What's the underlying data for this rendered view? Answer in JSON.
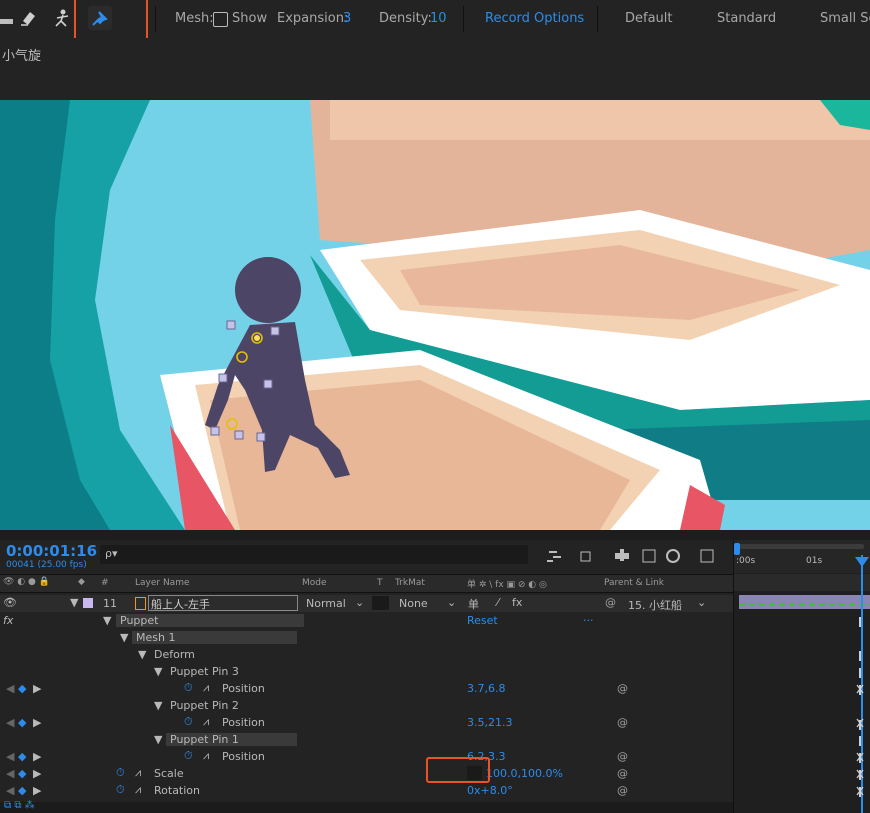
{
  "toolbar": {
    "tools": [
      {
        "name": "shape-tool-icon",
        "glyph": "▬"
      },
      {
        "name": "eraser-icon",
        "glyph": "◆"
      },
      {
        "name": "roto-brush-icon",
        "glyph": "✦"
      },
      {
        "name": "puppet-pin-icon",
        "glyph": "📌"
      }
    ],
    "mesh_label": "Mesh:",
    "show_label": "Show",
    "expansion_label": "Expansion:",
    "expansion_value": "3",
    "density_label": "Density:",
    "density_value": "10",
    "record_options": "Record Options",
    "workspaces": [
      "Default",
      "Standard",
      "Small Scr"
    ]
  },
  "comp": {
    "name": "小气旋"
  },
  "timeline": {
    "time": "0:00:01:16",
    "frame": "00041 (25.00 fps)",
    "search_placeholder": "ρ▾",
    "ruler": [
      ":00s",
      "01s"
    ],
    "columns": {
      "layer_name": "Layer Name",
      "mode": "Mode",
      "t": "T",
      "trkmat": "TrkMat",
      "switches": "单 ✲ \\ fx ▣ ⊘ ◐ ◎",
      "parent": "Parent & Link",
      "num": "#"
    },
    "layer": {
      "num": "11",
      "name": "船上人-左手",
      "mode": "Normal",
      "trkmat": "None",
      "parent": "15. 小红船"
    },
    "effects": {
      "fx": "fx",
      "puppet": "Puppet",
      "reset": "Reset",
      "reset_dash": "...",
      "mesh": "Mesh 1",
      "deform": "Deform",
      "pin3": "Puppet Pin 3",
      "pin3_pos_label": "Position",
      "pin3_pos": "3.7,6.8",
      "pin2": "Puppet Pin 2",
      "pin2_pos_label": "Position",
      "pin2_pos": "3.5,21.3",
      "pin1": "Puppet Pin 1",
      "pin1_pos_label": "Position",
      "pin1_pos": "6.2,3.3",
      "scale_label": "Scale",
      "scale_val": "100.0,100.0%",
      "rotation_label": "Rotation",
      "rotation_val": "0x+8.0°"
    }
  },
  "colors": {
    "accent": "#2d8ceb",
    "highlight": "#e8532a"
  }
}
